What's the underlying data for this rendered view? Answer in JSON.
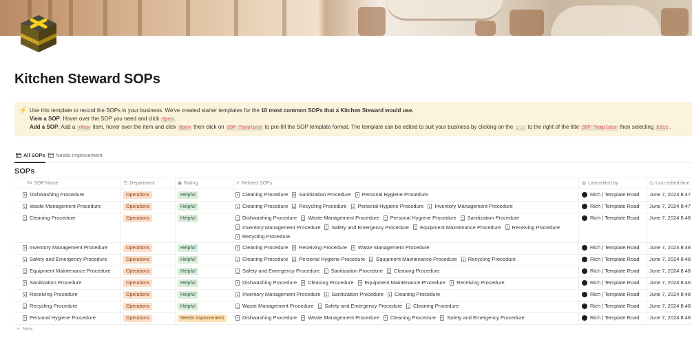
{
  "page": {
    "title": "Kitchen Steward SOPs"
  },
  "callout": {
    "line1_a": "Use this template to record the SOPs in your business. We've created starter templates for the ",
    "line1_b": "10 most common SOPs that a Kitchen Steward would use.",
    "line2_label": "View a SOP",
    "line2_text": ": Hover over the SOP you need and click ",
    "line2_code": "Open",
    "line2_end": ".",
    "line3_label": "Add a SOP",
    "line3_t1": ": Add a ",
    "line3_code1": "+New",
    "line3_t2": " item, hover over the item and click ",
    "line3_code2": "Open",
    "line3_t3": " then click on ",
    "line3_code3": "SOP Template",
    "line3_t4": " to pre-fill the SOP template format. The template can be edited to suit your business by clicking on the ",
    "line3_code4": "...",
    "line3_t5": " to the right of the title ",
    "line3_code5": "SOP Template",
    "line3_t6": " then selecting ",
    "line3_code6": "Edit",
    "line3_end": "."
  },
  "tabs": [
    {
      "label": "All SOPs",
      "icon": "table-icon"
    },
    {
      "label": "Needs Improvement",
      "icon": "table-icon"
    }
  ],
  "database": {
    "title": "SOPs",
    "columns": {
      "name": "SOP Name",
      "department": "Department",
      "rating": "Rating",
      "related": "Related SOPs",
      "edited_by": "Last edited by",
      "edited_time": "Last edited time"
    },
    "new_label": "New",
    "rows": [
      {
        "name": "Dishwashing Procedure",
        "department": "Operations",
        "rating": "Helpful",
        "related": [
          [
            "Cleaning Procedure",
            "Sanitization Procedure",
            "Personal Hygiene Procedure"
          ]
        ],
        "edited_by": "Rich | Template Road",
        "edited_time": "June 7, 2024 8:47"
      },
      {
        "name": "Waste Management Procedure",
        "department": "Operations",
        "rating": "Helpful",
        "related": [
          [
            "Cleaning Procedure",
            "Recycling Procedure",
            "Personal Hygiene Procedure",
            "Inventory Management Procedure"
          ]
        ],
        "edited_by": "Rich | Template Road",
        "edited_time": "June 7, 2024 8:47"
      },
      {
        "name": "Cleaning Procedure",
        "department": "Operations",
        "rating": "Helpful",
        "related": [
          [
            "Dishwashing Procedure",
            "Waste Management Procedure",
            "Personal Hygiene Procedure",
            "Sanitization Procedure"
          ],
          [
            "Inventory Management Procedure",
            "Safety and Emergency Procedure",
            "Equipment Maintenance Procedure",
            "Receiving Procedure"
          ],
          [
            "Recycling Procedure"
          ]
        ],
        "edited_by": "Rich | Template Road",
        "edited_time": "June 7, 2024 8:48"
      },
      {
        "name": "Inventory Management Procedure",
        "department": "Operations",
        "rating": "Helpful",
        "related": [
          [
            "Cleaning Procedure",
            "Receiving Procedure",
            "Waste Management Procedure"
          ]
        ],
        "edited_by": "Rich | Template Road",
        "edited_time": "June 7, 2024 8:48"
      },
      {
        "name": "Safety and Emergency Procedure",
        "department": "Operations",
        "rating": "Helpful",
        "related": [
          [
            "Cleaning Procedure",
            "Personal Hygiene Procedure",
            "Equipment Maintenance Procedure",
            "Recycling Procedure"
          ]
        ],
        "edited_by": "Rich | Template Road",
        "edited_time": "June 7, 2024 8:48"
      },
      {
        "name": "Equipment Maintenance Procedure",
        "department": "Operations",
        "rating": "Helpful",
        "related": [
          [
            "Safety and Emergency Procedure",
            "Sanitization Procedure",
            "Cleaning Procedure"
          ]
        ],
        "edited_by": "Rich | Template Road",
        "edited_time": "June 7, 2024 8:48"
      },
      {
        "name": "Sanitization Procedure",
        "department": "Operations",
        "rating": "Helpful",
        "related": [
          [
            "Dishwashing Procedure",
            "Cleaning Procedure",
            "Equipment Maintenance Procedure",
            "Receiving Procedure"
          ]
        ],
        "edited_by": "Rich | Template Road",
        "edited_time": "June 7, 2024 8:46"
      },
      {
        "name": "Receiving Procedure",
        "department": "Operations",
        "rating": "Helpful",
        "related": [
          [
            "Inventory Management Procedure",
            "Sanitization Procedure",
            "Cleaning Procedure"
          ]
        ],
        "edited_by": "Rich | Template Road",
        "edited_time": "June 7, 2024 8:48"
      },
      {
        "name": "Recycling Procedure",
        "department": "Operations",
        "rating": "Helpful",
        "related": [
          [
            "Waste Management Procedure",
            "Safety and Emergency Procedure",
            "Cleaning Procedure"
          ]
        ],
        "edited_by": "Rich | Template Road",
        "edited_time": "June 7, 2024 8:48"
      },
      {
        "name": "Personal Hygiene Procedure",
        "department": "Operations",
        "rating": "Needs Improvement",
        "related": [
          [
            "Dishwashing Procedure",
            "Waste Management Procedure",
            "Cleaning Procedure",
            "Safety and Emergency Procedure"
          ]
        ],
        "edited_by": "Rich | Template Road",
        "edited_time": "June 7, 2024 8:48"
      }
    ]
  },
  "colors": {
    "callout_bg": "#fbf3db",
    "tag_operations": "#fbdfcb",
    "tag_helpful": "#dbeddb",
    "tag_needs_improvement": "#fce2b7"
  }
}
